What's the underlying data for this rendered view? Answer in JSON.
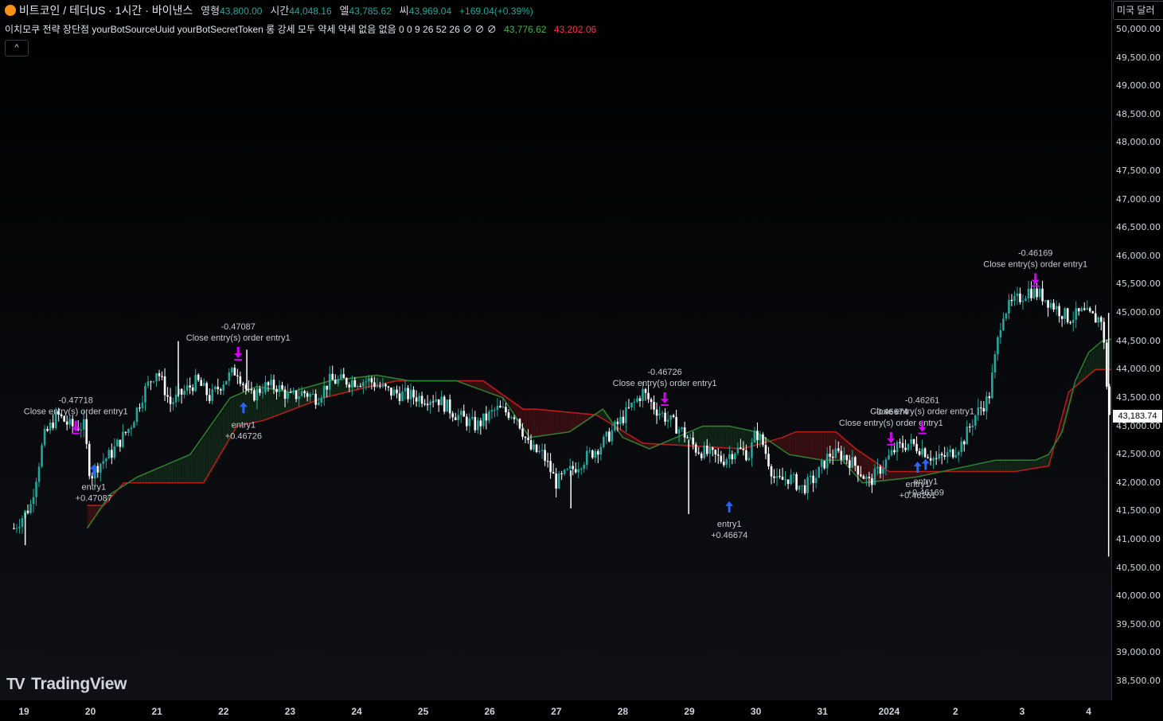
{
  "header": {
    "symbol": "비트코인 / 테더US · 1시간 · 바이낸스",
    "open_label": "영형",
    "open": "43,800.00",
    "high_label": "시간",
    "high": "44,048.16",
    "low_label": "엘",
    "low": "43,785.62",
    "close_label": "씨",
    "close": "43,969.04",
    "change": "+169.04(+0.39%)"
  },
  "indicator": {
    "text": "이치모쿠 전략 장단점 yourBotSourceUuid yourBotSecretToken 롱 강세 모두 약세 약세 없음 없음 0 0 9 26 52 26  ∅ ∅ ∅",
    "value_green": "43,776.62",
    "value_red": "43,202.06"
  },
  "collapse_button": "^",
  "currency_button": "미국 달러",
  "last_price": "43,183.74",
  "logo_text": "TradingView",
  "colors": {
    "up": "#26a69a",
    "down": "#ffffff",
    "cloud_green": "#2e7d32",
    "cloud_red": "#b71c1c",
    "long_arrow": "#2962ff",
    "close_arrow": "#d500f9"
  },
  "chart_data": {
    "type": "candlestick",
    "y_ticks": [
      "50,000.00",
      "49,500.00",
      "49,000.00",
      "48,500.00",
      "48,000.00",
      "47,500.00",
      "47,000.00",
      "46,500.00",
      "46,000.00",
      "45,500.00",
      "45,000.00",
      "44,500.00",
      "44,000.00",
      "43,500.00",
      "43,000.00",
      "42,500.00",
      "42,000.00",
      "41,500.00",
      "41,000.00",
      "40,500.00",
      "40,000.00",
      "39,500.00",
      "39,000.00",
      "38,500.00"
    ],
    "ylim": [
      38300,
      50300
    ],
    "x_ticks": [
      "19",
      "20",
      "21",
      "22",
      "23",
      "24",
      "25",
      "26",
      "27",
      "28",
      "29",
      "30",
      "31",
      "2024",
      "2",
      "3",
      "4"
    ],
    "x_range": [
      0,
      16.8
    ],
    "price_path": [
      [
        -0.15,
        41200
      ],
      [
        0.1,
        41600
      ],
      [
        0.3,
        42800
      ],
      [
        0.5,
        43200
      ],
      [
        0.7,
        43000
      ],
      [
        0.9,
        43000
      ],
      [
        1.0,
        42100
      ],
      [
        1.1,
        42300
      ],
      [
        1.3,
        42500
      ],
      [
        1.6,
        43000
      ],
      [
        1.8,
        43600
      ],
      [
        2.0,
        44000
      ],
      [
        2.2,
        43400
      ],
      [
        2.4,
        43600
      ],
      [
        2.6,
        43800
      ],
      [
        2.8,
        43500
      ],
      [
        3.0,
        43800
      ],
      [
        3.2,
        44000
      ],
      [
        3.4,
        43500
      ],
      [
        3.6,
        43700
      ],
      [
        3.8,
        43700
      ],
      [
        4.0,
        43500
      ],
      [
        4.2,
        43600
      ],
      [
        4.4,
        43500
      ],
      [
        4.6,
        43800
      ],
      [
        4.9,
        43800
      ],
      [
        5.2,
        43800
      ],
      [
        5.5,
        43600
      ],
      [
        6.0,
        43500
      ],
      [
        6.2,
        43500
      ],
      [
        6.5,
        43200
      ],
      [
        6.8,
        43000
      ],
      [
        7.1,
        43300
      ],
      [
        7.4,
        43200
      ],
      [
        7.6,
        42600
      ],
      [
        7.8,
        42500
      ],
      [
        8.0,
        42000
      ],
      [
        8.2,
        42200
      ],
      [
        8.4,
        42400
      ],
      [
        8.7,
        42700
      ],
      [
        8.9,
        43000
      ],
      [
        9.1,
        43300
      ],
      [
        9.3,
        43600
      ],
      [
        9.5,
        43300
      ],
      [
        9.7,
        43100
      ],
      [
        9.9,
        42900
      ],
      [
        10.1,
        42600
      ],
      [
        10.3,
        42500
      ],
      [
        10.5,
        42400
      ],
      [
        10.7,
        42600
      ],
      [
        10.9,
        42500
      ],
      [
        11.0,
        42900
      ],
      [
        11.1,
        42700
      ],
      [
        11.3,
        42000
      ],
      [
        11.5,
        42100
      ],
      [
        11.7,
        41900
      ],
      [
        11.9,
        42100
      ],
      [
        12.1,
        42500
      ],
      [
        12.3,
        42500
      ],
      [
        12.5,
        42300
      ],
      [
        12.7,
        42000
      ],
      [
        12.9,
        42300
      ],
      [
        13.1,
        42600
      ],
      [
        13.3,
        42700
      ],
      [
        13.5,
        42600
      ],
      [
        13.7,
        42400
      ],
      [
        13.9,
        42500
      ],
      [
        14.1,
        42700
      ],
      [
        14.3,
        43200
      ],
      [
        14.5,
        43500
      ],
      [
        14.7,
        45000
      ],
      [
        14.9,
        45200
      ],
      [
        15.1,
        45400
      ],
      [
        15.3,
        45300
      ],
      [
        15.5,
        45100
      ],
      [
        15.7,
        44900
      ],
      [
        15.9,
        45000
      ],
      [
        16.1,
        44900
      ],
      [
        16.2,
        44900
      ],
      [
        16.3,
        43300
      ],
      [
        16.45,
        42300
      ],
      [
        16.6,
        42700
      ],
      [
        16.75,
        42800
      ],
      [
        16.85,
        43050
      ]
    ],
    "wick_extremes": [
      [
        16.3,
        45000
      ],
      [
        16.3,
        40700
      ],
      [
        9.99,
        41450
      ],
      [
        8.22,
        41550
      ],
      [
        3.35,
        44350
      ],
      [
        2.32,
        44500
      ],
      [
        0.02,
        40900
      ]
    ],
    "cloud_span_a": [
      [
        0.95,
        41200
      ],
      [
        1.3,
        41800
      ],
      [
        1.7,
        42100
      ],
      [
        2.5,
        42500
      ],
      [
        3.1,
        43500
      ],
      [
        3.5,
        43700
      ],
      [
        4.0,
        43600
      ],
      [
        4.6,
        43800
      ],
      [
        5.3,
        43900
      ],
      [
        5.8,
        43800
      ],
      [
        6.5,
        43800
      ],
      [
        7.2,
        43500
      ],
      [
        7.6,
        42800
      ],
      [
        8.2,
        42900
      ],
      [
        8.7,
        43300
      ],
      [
        9.0,
        42800
      ],
      [
        9.4,
        42600
      ],
      [
        10.2,
        43000
      ],
      [
        10.6,
        43000
      ],
      [
        11.0,
        42900
      ],
      [
        11.5,
        42500
      ],
      [
        12.0,
        42400
      ],
      [
        12.3,
        42400
      ],
      [
        12.6,
        42000
      ],
      [
        13.4,
        42100
      ],
      [
        13.8,
        42200
      ],
      [
        14.2,
        42300
      ],
      [
        14.6,
        42400
      ],
      [
        15.2,
        42400
      ],
      [
        15.4,
        42500
      ],
      [
        15.6,
        42900
      ],
      [
        15.8,
        43800
      ],
      [
        16.0,
        44300
      ],
      [
        16.2,
        44500
      ],
      [
        16.6,
        44600
      ],
      [
        16.9,
        44600
      ],
      [
        17.1,
        45000
      ]
    ],
    "cloud_span_b": [
      [
        0.95,
        41600
      ],
      [
        1.2,
        41600
      ],
      [
        1.5,
        42000
      ],
      [
        2.7,
        42000
      ],
      [
        3.2,
        43000
      ],
      [
        3.6,
        43100
      ],
      [
        4.5,
        43500
      ],
      [
        5.2,
        43700
      ],
      [
        5.6,
        43800
      ],
      [
        6.9,
        43800
      ],
      [
        7.5,
        43300
      ],
      [
        7.7,
        43300
      ],
      [
        8.6,
        43200
      ],
      [
        9.3,
        42700
      ],
      [
        10.8,
        42600
      ],
      [
        11.4,
        42800
      ],
      [
        11.6,
        42900
      ],
      [
        12.2,
        42900
      ],
      [
        12.5,
        42600
      ],
      [
        13.0,
        42200
      ],
      [
        13.6,
        42200
      ],
      [
        14.2,
        42200
      ],
      [
        14.9,
        42200
      ],
      [
        15.4,
        42300
      ],
      [
        15.7,
        43600
      ],
      [
        16.1,
        44000
      ],
      [
        16.7,
        44000
      ],
      [
        17.1,
        44000
      ]
    ],
    "markers": [
      {
        "x": 1.05,
        "y": 42100,
        "kind": "long",
        "label": "entry1",
        "value": "+0.47087"
      },
      {
        "x": 3.3,
        "y": 43200,
        "kind": "long",
        "label": "entry1",
        "value": "+0.46726"
      },
      {
        "x": 10.6,
        "y": 41450,
        "kind": "long",
        "label": "entry1",
        "value": "+0.46674"
      },
      {
        "x": 13.43,
        "y": 42150,
        "kind": "long",
        "label": "entry1",
        "value": "+0.46261"
      },
      {
        "x": 13.55,
        "y": 42200,
        "kind": "long",
        "label": "entry1",
        "value": "+0.46169"
      },
      {
        "x": 0.78,
        "y": 42900,
        "kind": "close",
        "label": "Close entry(s) order entry1",
        "value": "-0.47718"
      },
      {
        "x": 3.22,
        "y": 44200,
        "kind": "close",
        "label": "Close entry(s) order entry1",
        "value": "-0.47087"
      },
      {
        "x": 9.63,
        "y": 43400,
        "kind": "close",
        "label": "Close entry(s) order entry1",
        "value": "-0.46726"
      },
      {
        "x": 13.03,
        "y": 42700,
        "kind": "close",
        "label": "Close entry(s) order entry1",
        "value": "-0.46674"
      },
      {
        "x": 13.5,
        "y": 42900,
        "kind": "close",
        "label": "Close entry(s) order entry1",
        "value": "-0.46261"
      },
      {
        "x": 15.2,
        "y": 45500,
        "kind": "close",
        "label": "Close entry(s) order entry1",
        "value": "-0.46169"
      }
    ]
  }
}
